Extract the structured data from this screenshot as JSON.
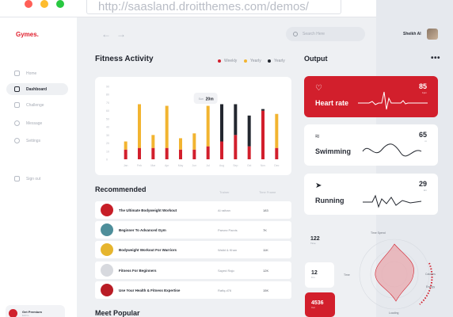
{
  "browser": {
    "url": "http://saasland.droitthemes.com/demos/"
  },
  "sidebar": {
    "brand": "Gymes.",
    "items": [
      {
        "label": "Home",
        "icon": "home-icon",
        "active": false
      },
      {
        "label": "Dashboard",
        "icon": "activity-icon",
        "active": true
      },
      {
        "label": "Challenge",
        "icon": "calendar-icon",
        "active": false
      },
      {
        "label": "Message",
        "icon": "chat-icon",
        "active": false
      },
      {
        "label": "Settings",
        "icon": "gear-icon",
        "active": false
      }
    ],
    "signout": "Sign out",
    "premium": {
      "title": "Get Premium",
      "subtitle": "$10/m"
    }
  },
  "header": {
    "search_placeholder": "Search Here",
    "user_name": "Sheikh Al"
  },
  "activity": {
    "title": "Fitness Activity",
    "legend": [
      {
        "label": "Weekly",
        "color": "#d21f2c"
      },
      {
        "label": "Yearly",
        "color": "#f2b430"
      },
      {
        "label": "Yearly",
        "color": "#23272f"
      }
    ],
    "tooltip": {
      "prefix": "Sun",
      "value": "20m"
    }
  },
  "chart_data": {
    "type": "bar",
    "categories": [
      "Jan",
      "Feb",
      "Mar",
      "Apr",
      "May",
      "Jun",
      "Jul",
      "Aug",
      "Sep",
      "Oct",
      "Nov",
      "Dec"
    ],
    "ylim": [
      0,
      90
    ],
    "y_ticks": [
      0,
      10,
      20,
      30,
      40,
      50,
      60,
      70,
      80,
      90
    ],
    "bars": [
      {
        "red": 12,
        "other": 10,
        "top": "yellow"
      },
      {
        "red": 14,
        "other": 54,
        "top": "yellow"
      },
      {
        "red": 14,
        "other": 16,
        "top": "yellow"
      },
      {
        "red": 14,
        "other": 52,
        "top": "yellow"
      },
      {
        "red": 12,
        "other": 14,
        "top": "yellow"
      },
      {
        "red": 12,
        "other": 20,
        "top": "yellow"
      },
      {
        "red": 16,
        "other": 50,
        "top": "yellow"
      },
      {
        "red": 22,
        "other": 46,
        "top": "dark"
      },
      {
        "red": 30,
        "other": 38,
        "top": "dark"
      },
      {
        "red": 16,
        "other": 38,
        "top": "dark"
      },
      {
        "red": 60,
        "other": 2,
        "top": "dark"
      },
      {
        "red": 14,
        "other": 42,
        "top": "yellow"
      }
    ]
  },
  "recommended": {
    "title": "Recommended",
    "col_trainer": "Trainer",
    "col_score": "Time Frame",
    "rows": [
      {
        "name": "The Ultimate Bodyweight Workout",
        "trainer": "Al raihan",
        "score": "183",
        "thumb": "#c71e27"
      },
      {
        "name": "Beginner To Advanced Gym",
        "trainer": "Parvez Parvis",
        "score": "7K",
        "thumb": "#4e8e9a"
      },
      {
        "name": "Bodyweight Workout For Warriors",
        "trainer": "Walid & Khan",
        "score": "11K",
        "thumb": "#e6b52e"
      },
      {
        "name": "Fitness For Beginners",
        "trainer": "Sayed Rajo",
        "score": "12K",
        "thumb": "#d7d9de"
      },
      {
        "name": "Use Your Health & Fitness Expertise",
        "trainer": "Rafiq.d76",
        "score": "15K",
        "thumb": "#b91c25"
      }
    ]
  },
  "popular": {
    "title": "Meet Popular"
  },
  "output": {
    "title": "Output",
    "cards": [
      {
        "label": "Heart rate",
        "value": "85",
        "unit": "bpm",
        "icon": "heart-icon"
      },
      {
        "label": "Swimming",
        "value": "65",
        "unit": "m",
        "icon": "swim-icon"
      },
      {
        "label": "Running",
        "value": "29",
        "unit": "km",
        "icon": "run-icon"
      }
    ],
    "stats": [
      {
        "value": "122",
        "label": "Time"
      },
      {
        "value": "12",
        "label": "Km"
      },
      {
        "value": "4536",
        "label": "Cal"
      }
    ],
    "radar_labels": [
      "Time Spend",
      "Time",
      "Calories",
      "Energy",
      "Loading"
    ]
  }
}
